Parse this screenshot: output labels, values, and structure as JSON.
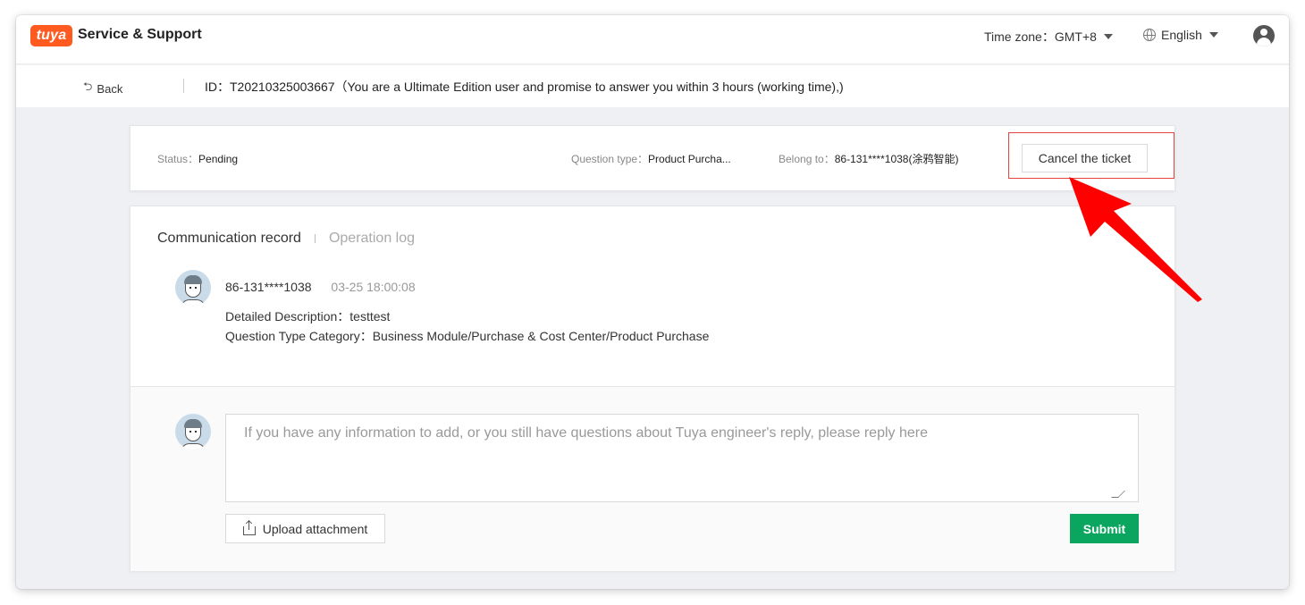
{
  "header": {
    "logo_text": "tuya",
    "title": "Service & Support",
    "timezone_label": "Time zone：GMT+8",
    "language_label": "English"
  },
  "subbar": {
    "back_label": "Back",
    "ticket_info": "ID：T20210325003667（You are a Ultimate Edition user and promise to answer you within 3 hours (working time),)"
  },
  "status_card": {
    "status_key": "Status：",
    "status_value": "Pending",
    "question_type_key": "Question type：",
    "question_type_value": "Product Purcha...",
    "belong_to_key": "Belong to：",
    "belong_to_value": "86-131****1038(涂鸦智能)",
    "cancel_label": "Cancel the ticket"
  },
  "tabs": {
    "active": "Communication record",
    "inactive": "Operation log"
  },
  "message": {
    "user": "86-131****1038",
    "time": "03-25 18:00:08",
    "description": "Detailed Description：testtest",
    "category": "Question Type Category：Business Module/Purchase & Cost Center/Product Purchase"
  },
  "reply": {
    "placeholder": "If you have any information to add, or you still have questions about Tuya engineer's reply, please reply here",
    "upload_label": "Upload attachment",
    "submit_label": "Submit"
  },
  "colors": {
    "brand": "#ff5a1f",
    "submit": "#0aa55e",
    "highlight": "#e8423f",
    "arrow": "#ff0000"
  }
}
